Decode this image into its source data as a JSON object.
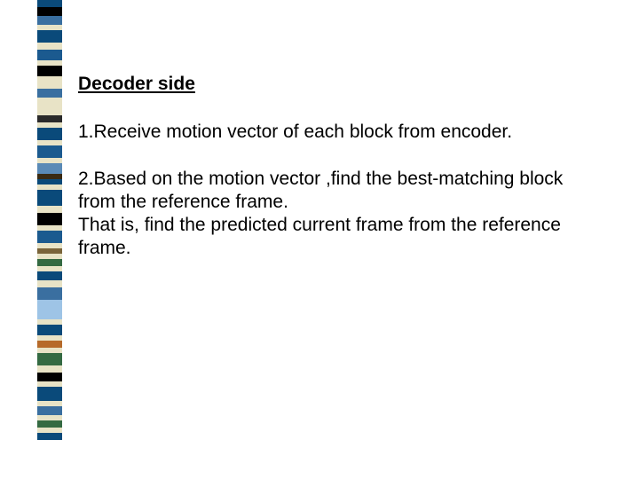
{
  "heading": "Decoder side",
  "para1": "1.Receive motion vector of each block from encoder.",
  "para2": "2.Based on the motion vector ,find the best-matching block from the reference  frame.",
  "para2b": "That is, find the predicted current frame from the reference frame.",
  "stripes": [
    {
      "c": "#0a4a7a",
      "h": 8
    },
    {
      "c": "#000000",
      "h": 10
    },
    {
      "c": "#3a6fa0",
      "h": 10
    },
    {
      "c": "#e8e3c6",
      "h": 6
    },
    {
      "c": "#0a4a7a",
      "h": 14
    },
    {
      "c": "#e8e3c6",
      "h": 8
    },
    {
      "c": "#1b5a8f",
      "h": 12
    },
    {
      "c": "#e8e3c6",
      "h": 6
    },
    {
      "c": "#000000",
      "h": 12
    },
    {
      "c": "#e8e3c6",
      "h": 14
    },
    {
      "c": "#3a6fa0",
      "h": 10
    },
    {
      "c": "#e8e3c6",
      "h": 20
    },
    {
      "c": "#2a2a2a",
      "h": 8
    },
    {
      "c": "#e8e3c6",
      "h": 6
    },
    {
      "c": "#0a4a7a",
      "h": 14
    },
    {
      "c": "#e8e3c6",
      "h": 6
    },
    {
      "c": "#1b5a8f",
      "h": 14
    },
    {
      "c": "#e8e3c6",
      "h": 6
    },
    {
      "c": "#5a8ab6",
      "h": 12
    },
    {
      "c": "#3a2a12",
      "h": 6
    },
    {
      "c": "#0a4a7a",
      "h": 6
    },
    {
      "c": "#e8e3c6",
      "h": 6
    },
    {
      "c": "#0a4a7a",
      "h": 18
    },
    {
      "c": "#e8e3c6",
      "h": 8
    },
    {
      "c": "#000000",
      "h": 14
    },
    {
      "c": "#e8e3c6",
      "h": 6
    },
    {
      "c": "#1b5a8f",
      "h": 14
    },
    {
      "c": "#e8e3c6",
      "h": 6
    },
    {
      "c": "#7a643a",
      "h": 6
    },
    {
      "c": "#e8e3c6",
      "h": 6
    },
    {
      "c": "#346a42",
      "h": 8
    },
    {
      "c": "#e8e3c6",
      "h": 6
    },
    {
      "c": "#0a4a7a",
      "h": 10
    },
    {
      "c": "#e8e3c6",
      "h": 8
    },
    {
      "c": "#3a6fa0",
      "h": 14
    },
    {
      "c": "#9ec4e6",
      "h": 22
    },
    {
      "c": "#e8e3c6",
      "h": 6
    },
    {
      "c": "#0a4a7a",
      "h": 12
    },
    {
      "c": "#e8e3c6",
      "h": 6
    },
    {
      "c": "#b66a2a",
      "h": 8
    },
    {
      "c": "#e8e3c6",
      "h": 6
    },
    {
      "c": "#346a42",
      "h": 14
    },
    {
      "c": "#e8e3c6",
      "h": 8
    },
    {
      "c": "#000000",
      "h": 10
    },
    {
      "c": "#e8e3c6",
      "h": 6
    },
    {
      "c": "#0a4a7a",
      "h": 16
    },
    {
      "c": "#e8e3c6",
      "h": 6
    },
    {
      "c": "#3a6fa0",
      "h": 10
    },
    {
      "c": "#e8e3c6",
      "h": 6
    },
    {
      "c": "#346a42",
      "h": 8
    },
    {
      "c": "#e8e3c6",
      "h": 6
    },
    {
      "c": "#0a4a7a",
      "h": 8
    }
  ]
}
